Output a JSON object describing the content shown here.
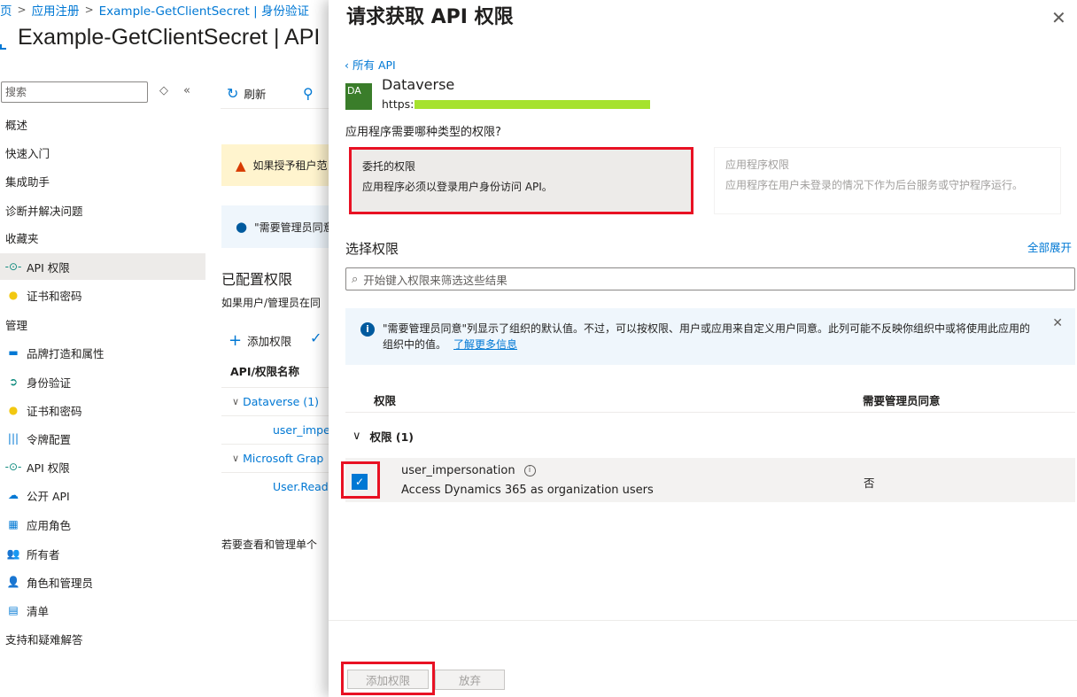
{
  "breadcrumb": [
    "页",
    "应用注册",
    "Example-GetClientSecret | 身份验证"
  ],
  "page_title": "Example-GetClientSecret | API",
  "sidebar": {
    "search_placeholder": "搜索",
    "items": [
      {
        "label": "概述",
        "icon": "none"
      },
      {
        "label": "快速入门",
        "icon": "none"
      },
      {
        "label": "集成助手",
        "icon": "none"
      },
      {
        "label": "诊断并解决问题",
        "icon": "none"
      },
      {
        "label": "收藏夹",
        "icon": "none"
      },
      {
        "label": "API 权限",
        "icon": "api-permission-icon",
        "active": true
      },
      {
        "label": "证书和密码",
        "icon": "key-icon"
      },
      {
        "label": "管理",
        "icon": "section"
      },
      {
        "label": "品牌打造和属性",
        "icon": "branding-icon"
      },
      {
        "label": "身份验证",
        "icon": "authentication-icon"
      },
      {
        "label": "证书和密码",
        "icon": "key-icon"
      },
      {
        "label": "令牌配置",
        "icon": "token-icon"
      },
      {
        "label": "API 权限",
        "icon": "api-permission-icon"
      },
      {
        "label": "公开 API",
        "icon": "cloud-icon"
      },
      {
        "label": "应用角色",
        "icon": "app-roles-icon"
      },
      {
        "label": "所有者",
        "icon": "owners-icon"
      },
      {
        "label": "角色和管理员",
        "icon": "roles-admins-icon"
      },
      {
        "label": "清单",
        "icon": "manifest-icon"
      },
      {
        "label": "支持和疑难解答",
        "icon": "none"
      }
    ]
  },
  "background": {
    "refresh_label": "刷新",
    "warning_text": "如果授予租户范",
    "info_text": "\"需要管理员同意",
    "configured_title": "已配置权限",
    "configured_sub": "如果用户/管理员在同",
    "add_permission_label": "添加权限",
    "table_header": "API/权限名称",
    "rows": [
      {
        "label": "Dataverse (1)",
        "group": true
      },
      {
        "label": "user_imper",
        "group": false
      },
      {
        "label": "Microsoft Grap",
        "group": true
      },
      {
        "label": "User.Read",
        "group": false
      }
    ],
    "footer_text": "若要查看和管理单个"
  },
  "panel": {
    "title": "请求获取 API 权限",
    "back_label": "所有 API",
    "api_logo": "DA",
    "api_name": "Dataverse",
    "api_url_prefix": "https:",
    "question": "应用程序需要哪种类型的权限?",
    "delegated": {
      "title": "委托的权限",
      "desc": "应用程序必须以登录用户身份访问 API。"
    },
    "application": {
      "title": "应用程序权限",
      "desc": "应用程序在用户未登录的情况下作为后台服务或守护程序运行。"
    },
    "select_label": "选择权限",
    "expand_all": "全部展开",
    "filter_placeholder": "开始键入权限来筛选这些结果",
    "info_text": "\"需要管理员同意\"列显示了组织的默认值。不过，可以按权限、用户或应用来自定义用户同意。此列可能不反映你组织中或将使用此应用的组织中的值。",
    "info_link": "了解更多信息",
    "col_permission": "权限",
    "col_admin": "需要管理员同意",
    "group_label": "权限 (1)",
    "permission": {
      "name": "user_impersonation",
      "desc": "Access Dynamics 365 as organization users",
      "admin_consent": "否",
      "checked": true
    },
    "add_button": "添加权限",
    "discard_button": "放弃"
  }
}
